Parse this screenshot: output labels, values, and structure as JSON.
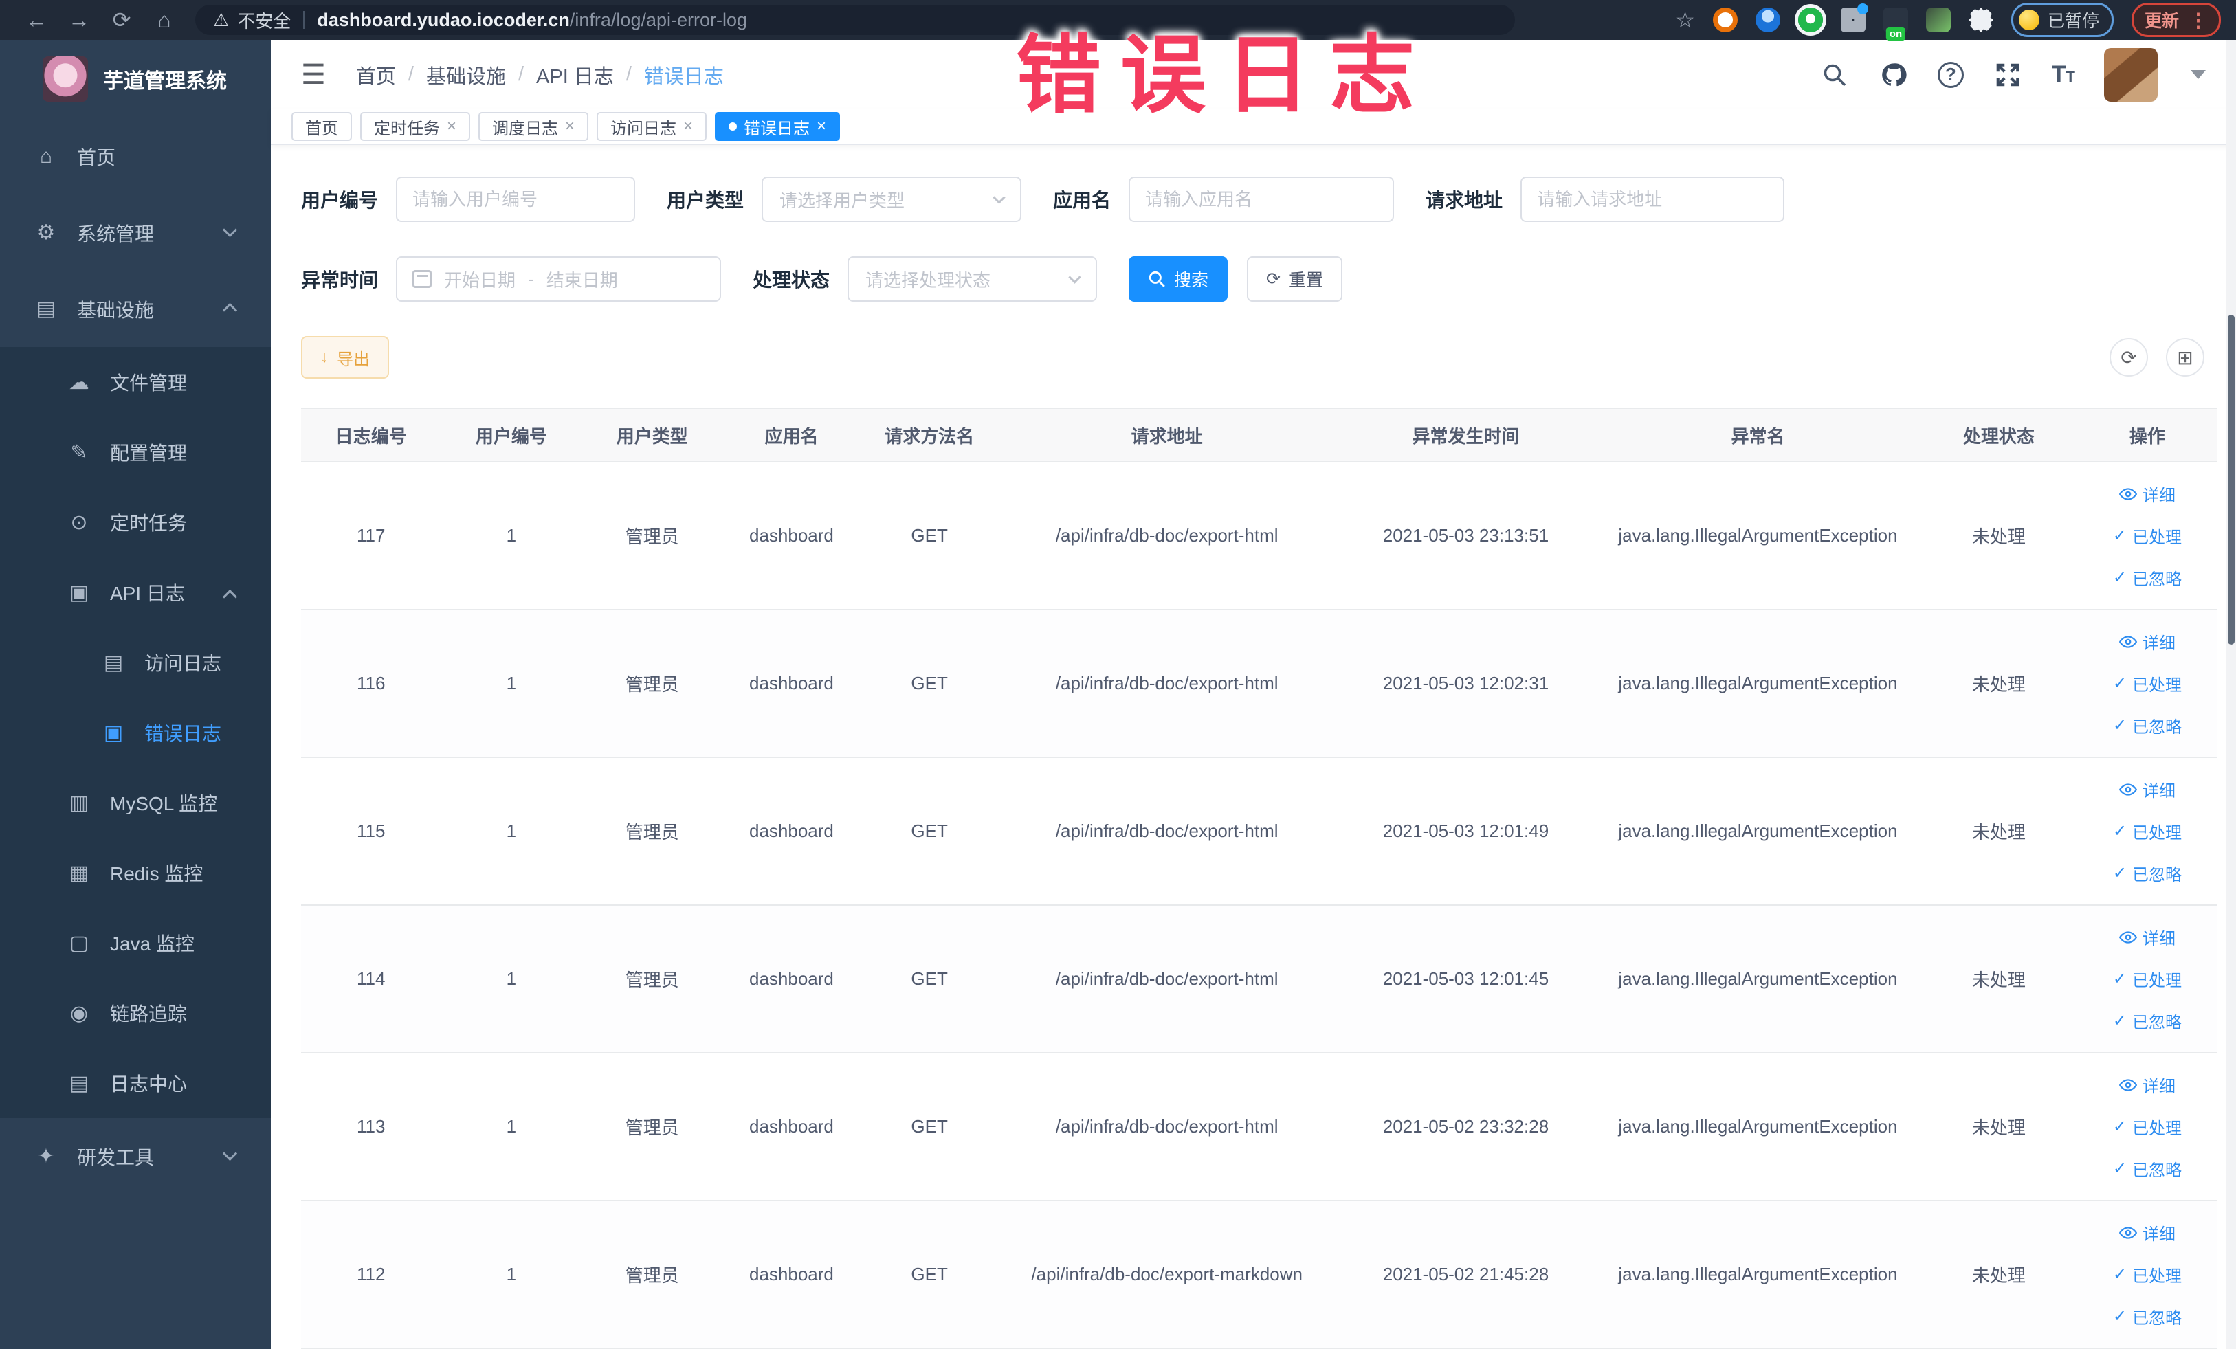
{
  "colors": {
    "accent": "#1890ff",
    "link_blue": "#2d8cf0",
    "sidebar_bg": "#2d4055",
    "sidebar_submenu_bg": "#233649",
    "active_menu": "#409eff",
    "overlay_pink": "#f43b5e",
    "export_warning": "#e6a23c"
  },
  "overlay": {
    "title": "错误日志"
  },
  "browser": {
    "security_label": "不安全",
    "url_host": "dashboard.yudao.iocoder.cn",
    "url_path": "/infra/log/api-error-log",
    "paused_label": "已暂停",
    "update_label": "更新"
  },
  "icons": {
    "back": "←",
    "forward": "→",
    "reload": "⟳",
    "home": "⌂",
    "warning": "⚠",
    "star": "☆",
    "hamburger": "☰",
    "dots": "⋮",
    "check": "✓",
    "refresh": "⟳",
    "grid": "⊞",
    "download": "↓",
    "menu_home": "⌂",
    "menu_system": "⚙",
    "menu_infra": "▤",
    "menu_file": "☁",
    "menu_config": "✎",
    "menu_job": "⊙",
    "menu_api": "▣",
    "menu_access": "▤",
    "menu_error": "▣",
    "menu_mysql": "▥",
    "menu_redis": "▦",
    "menu_java": "▢",
    "menu_trace": "◉",
    "menu_logcenter": "▤",
    "menu_tool": "✦"
  },
  "sidebar": {
    "app_title": "芋道管理系统",
    "items": [
      {
        "label": "首页"
      },
      {
        "label": "系统管理"
      },
      {
        "label": "基础设施"
      },
      {
        "label": "文件管理"
      },
      {
        "label": "配置管理"
      },
      {
        "label": "定时任务"
      },
      {
        "label": "API 日志"
      },
      {
        "label": "访问日志"
      },
      {
        "label": "错误日志"
      },
      {
        "label": "MySQL 监控"
      },
      {
        "label": "Redis 监控"
      },
      {
        "label": "Java 监控"
      },
      {
        "label": "链路追踪"
      },
      {
        "label": "日志中心"
      },
      {
        "label": "研发工具"
      }
    ]
  },
  "breadcrumb": {
    "separator": "/",
    "items": [
      {
        "label": "首页"
      },
      {
        "label": "基础设施"
      },
      {
        "label": "API 日志"
      },
      {
        "label": "错误日志"
      }
    ]
  },
  "tabs": [
    {
      "label": "首页"
    },
    {
      "label": "定时任务"
    },
    {
      "label": "调度日志"
    },
    {
      "label": "访问日志"
    },
    {
      "label": "错误日志"
    }
  ],
  "filters": {
    "user_id_label": "用户编号",
    "user_id_placeholder": "请输入用户编号",
    "user_type_label": "用户类型",
    "user_type_placeholder": "请选择用户类型",
    "app_name_label": "应用名",
    "app_name_placeholder": "请输入应用名",
    "request_url_label": "请求地址",
    "request_url_placeholder": "请输入请求地址",
    "exception_time_label": "异常时间",
    "date_start_placeholder": "开始日期",
    "date_separator": "-",
    "date_end_placeholder": "结束日期",
    "process_status_label": "处理状态",
    "process_status_placeholder": "请选择处理状态",
    "search_label": "搜索",
    "reset_label": "重置"
  },
  "toolbar": {
    "export_label": "导出"
  },
  "table": {
    "columns": [
      "日志编号",
      "用户编号",
      "用户类型",
      "应用名",
      "请求方法名",
      "请求地址",
      "异常发生时间",
      "异常名",
      "处理状态",
      "操作"
    ],
    "action_labels": {
      "detail": "详细",
      "processed": "已处理",
      "ignored": "已忽略"
    },
    "rows": [
      {
        "id": "117",
        "user_id": "1",
        "user_type": "管理员",
        "app": "dashboard",
        "method": "GET",
        "url": "/api/infra/db-doc/export-html",
        "time": "2021-05-03 23:13:51",
        "exception": "java.lang.IllegalArgumentException",
        "status": "未处理"
      },
      {
        "id": "116",
        "user_id": "1",
        "user_type": "管理员",
        "app": "dashboard",
        "method": "GET",
        "url": "/api/infra/db-doc/export-html",
        "time": "2021-05-03 12:02:31",
        "exception": "java.lang.IllegalArgumentException",
        "status": "未处理"
      },
      {
        "id": "115",
        "user_id": "1",
        "user_type": "管理员",
        "app": "dashboard",
        "method": "GET",
        "url": "/api/infra/db-doc/export-html",
        "time": "2021-05-03 12:01:49",
        "exception": "java.lang.IllegalArgumentException",
        "status": "未处理"
      },
      {
        "id": "114",
        "user_id": "1",
        "user_type": "管理员",
        "app": "dashboard",
        "method": "GET",
        "url": "/api/infra/db-doc/export-html",
        "time": "2021-05-03 12:01:45",
        "exception": "java.lang.IllegalArgumentException",
        "status": "未处理"
      },
      {
        "id": "113",
        "user_id": "1",
        "user_type": "管理员",
        "app": "dashboard",
        "method": "GET",
        "url": "/api/infra/db-doc/export-html",
        "time": "2021-05-02 23:32:28",
        "exception": "java.lang.IllegalArgumentException",
        "status": "未处理"
      },
      {
        "id": "112",
        "user_id": "1",
        "user_type": "管理员",
        "app": "dashboard",
        "method": "GET",
        "url": "/api/infra/db-doc/export-markdown",
        "time": "2021-05-02 21:45:28",
        "exception": "java.lang.IllegalArgumentException",
        "status": "未处理"
      }
    ]
  }
}
